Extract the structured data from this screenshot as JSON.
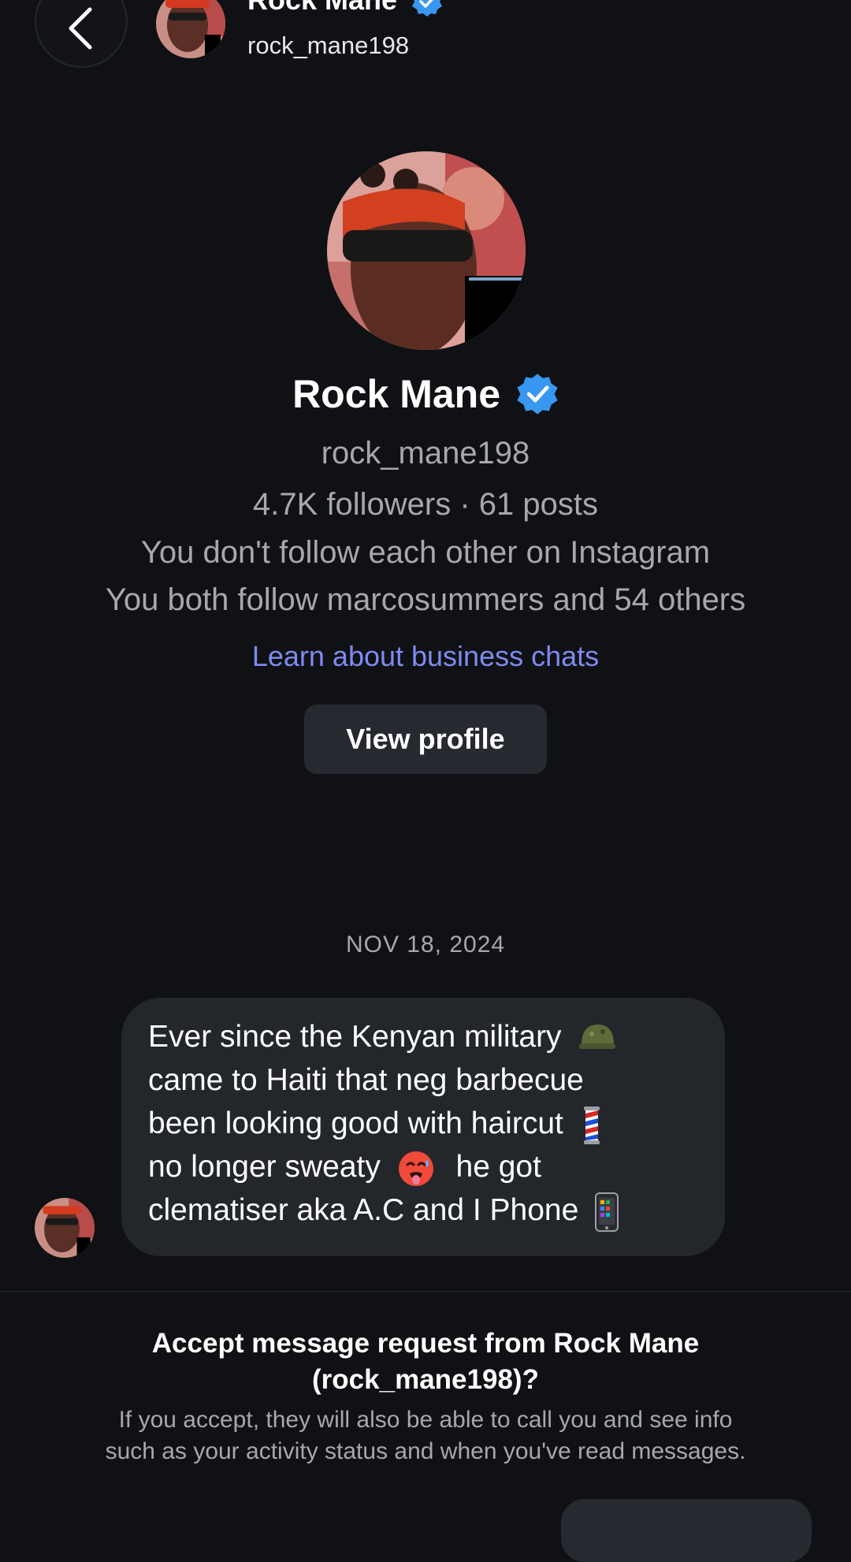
{
  "header": {
    "back_label": "Back",
    "name": "Rock Mane",
    "handle": "rock_mane198"
  },
  "profile": {
    "name": "Rock Mane",
    "handle": "rock_mane198",
    "stats": "4.7K followers · 61 posts",
    "follow_status": "You don't follow each other on Instagram",
    "mutuals": "You both follow marcosummers and 54 others",
    "learn_link": "Learn about business chats",
    "view_profile_label": "View profile"
  },
  "chat": {
    "date": "NOV 18, 2024",
    "message_lines": [
      "Ever since the Kenyan military",
      "came to Haiti that neg barbecue",
      "been looking good with haircut",
      "no longer sweaty",
      "he got",
      "clematiser aka A.C and I Phone"
    ]
  },
  "request": {
    "title_line1": "Accept message request from Rock Mane",
    "title_line2": "(rock_mane198)?",
    "desc_line1": "If you accept, they will also be able to call you and see info",
    "desc_line2": "such as your activity status and when you've read messages."
  },
  "colors": {
    "background": "#0f1114",
    "bubble": "#23262b",
    "link": "#7f8af0",
    "verified": "#3897f0",
    "muted_text": "#a6a8ad"
  }
}
